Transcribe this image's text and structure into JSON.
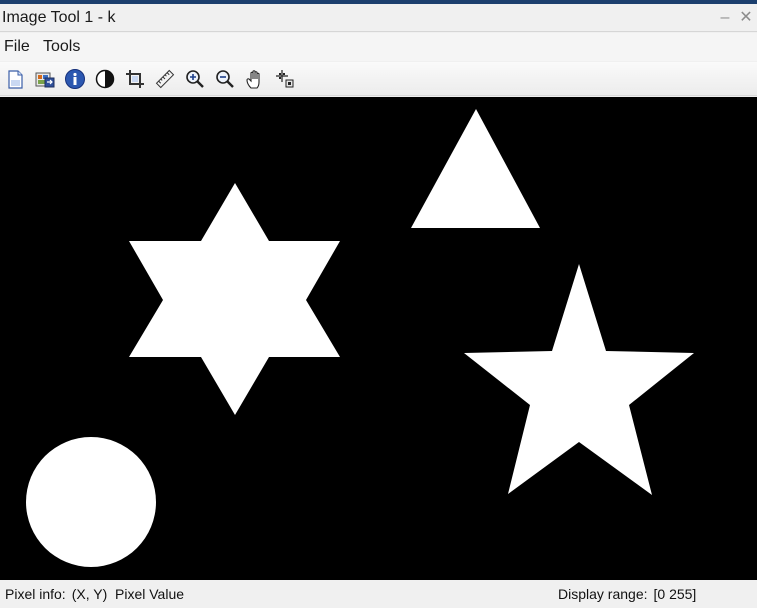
{
  "window": {
    "title": "Image Tool 1 - k",
    "accent_color": "#1c3f6e",
    "minimize_glyph": "–",
    "close_glyph": "✕"
  },
  "menu": {
    "items": [
      {
        "label": "File"
      },
      {
        "label": "Tools"
      }
    ]
  },
  "toolbar": {
    "buttons": [
      {
        "icon": "new-figure-icon"
      },
      {
        "icon": "export-to-workspace-icon"
      },
      {
        "icon": "image-information-icon"
      },
      {
        "icon": "adjust-contrast-icon"
      },
      {
        "icon": "crop-icon"
      },
      {
        "icon": "measure-distance-icon"
      },
      {
        "icon": "zoom-in-icon"
      },
      {
        "icon": "zoom-out-icon"
      },
      {
        "icon": "pan-hand-icon"
      },
      {
        "icon": "pixel-region-icon"
      }
    ]
  },
  "image": {
    "background_color": "#000000",
    "shape_color": "#ffffff",
    "shapes": [
      "triangle",
      "six-point-star",
      "five-point-star",
      "circle"
    ]
  },
  "status": {
    "pixel_info_label": "Pixel info:",
    "pixel_info_value": "(X, Y)  Pixel Value",
    "display_range_label": "Display range:",
    "display_range_value": "[0 255]"
  }
}
